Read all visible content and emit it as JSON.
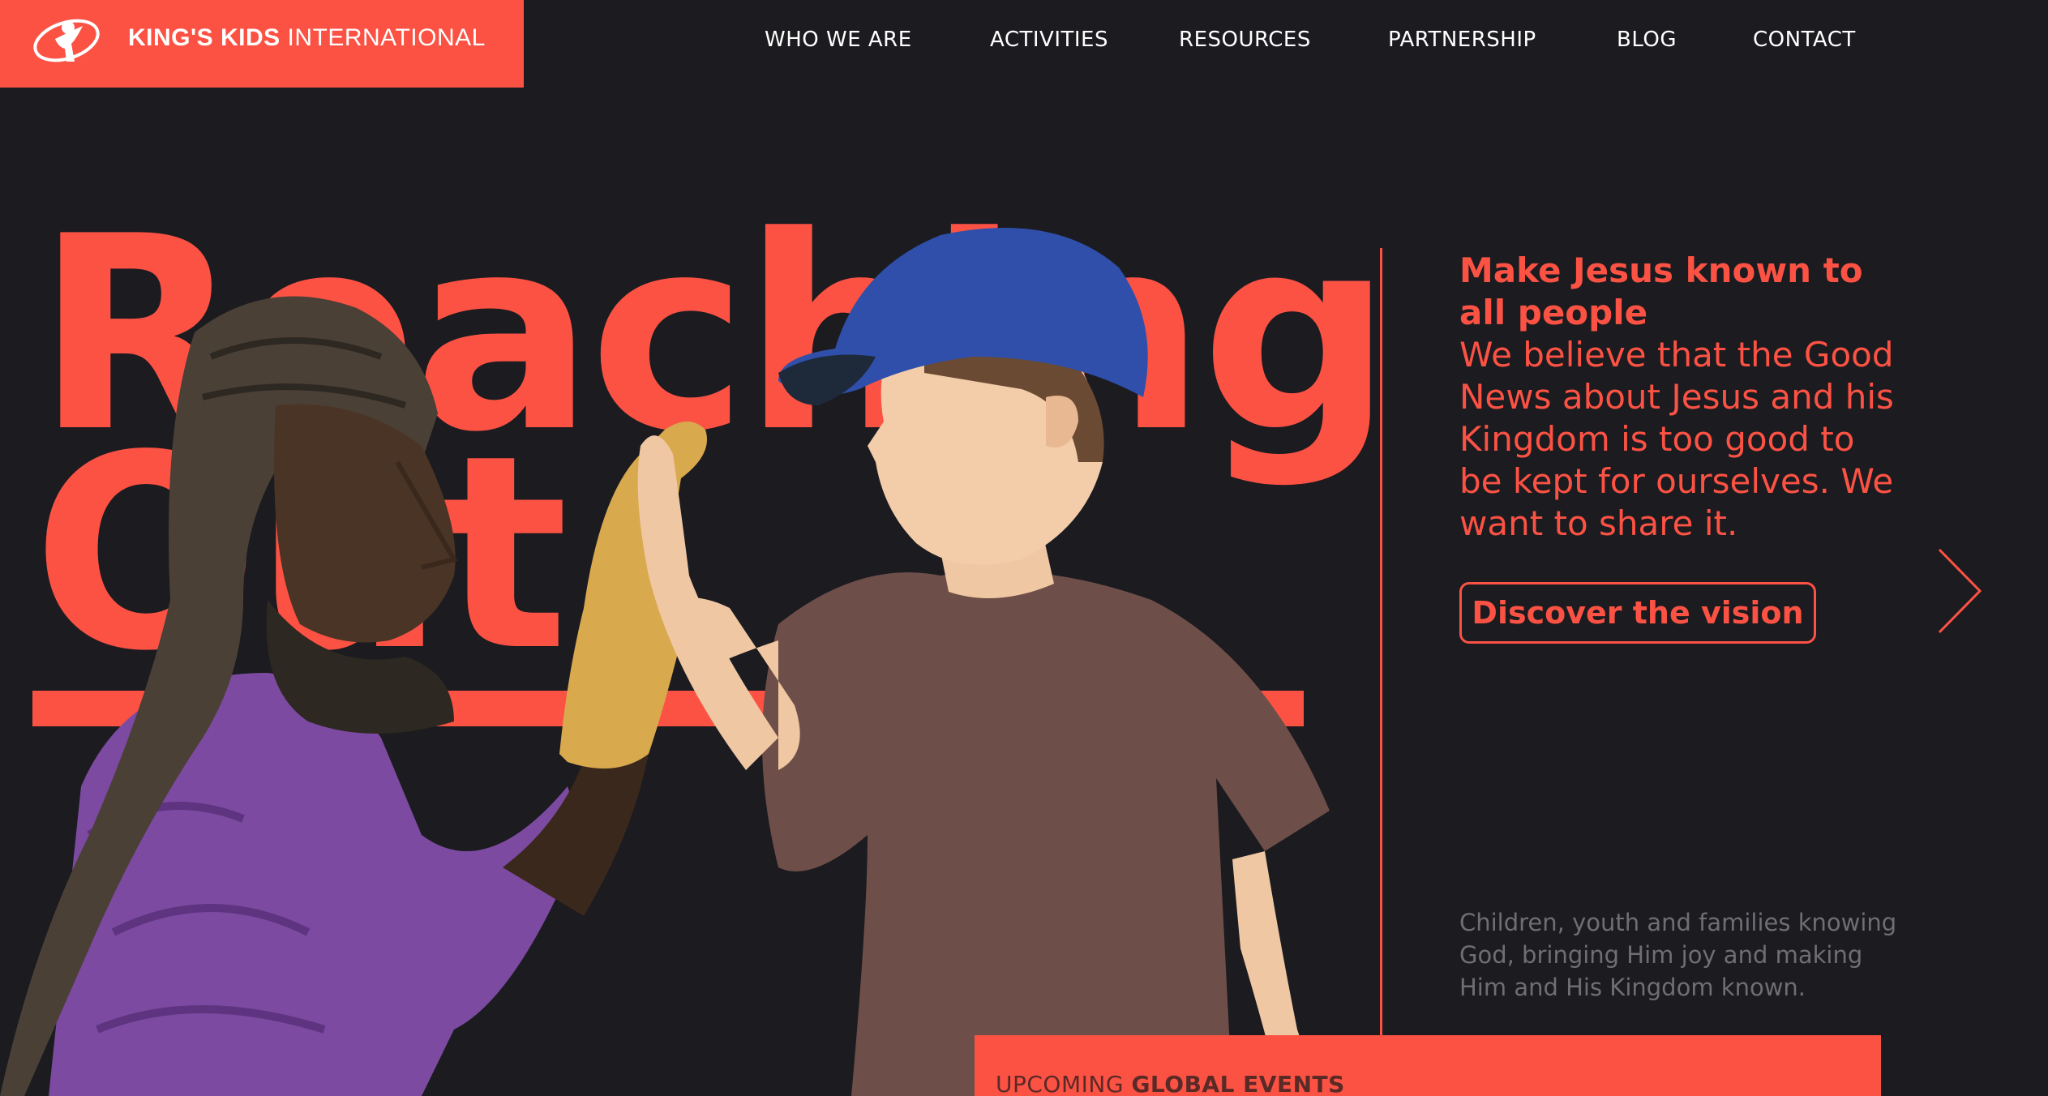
{
  "brand": {
    "name_bold": "KING'S KIDS",
    "name_regular": "INTERNATIONAL",
    "accent_color": "#fc5244",
    "background_color": "#1b1b20"
  },
  "nav": {
    "items": [
      {
        "label": "WHO WE ARE"
      },
      {
        "label": "ACTIVITIES"
      },
      {
        "label": "RESOURCES"
      },
      {
        "label": "PARTNERSHIP"
      },
      {
        "label": "BLOG"
      },
      {
        "label": "CONTACT"
      }
    ]
  },
  "hero": {
    "line1": "Reaching",
    "line2": "Out"
  },
  "mission": {
    "heading": "Make Jesus known to all people",
    "body": "We believe that the Good News about Jesus and his Kingdom is too good to be kept for ourselves. We want to share it.",
    "cta_label": "Discover the vision"
  },
  "tagline": "Children, youth and families knowing God, bringing Him joy and making Him and His Kingdom known.",
  "events": {
    "label_regular": "UPCOMING",
    "label_bold": "GLOBAL EVENTS"
  },
  "icons": {
    "logo": "kings-kids-figure-icon",
    "next": "chevron-right-icon"
  }
}
